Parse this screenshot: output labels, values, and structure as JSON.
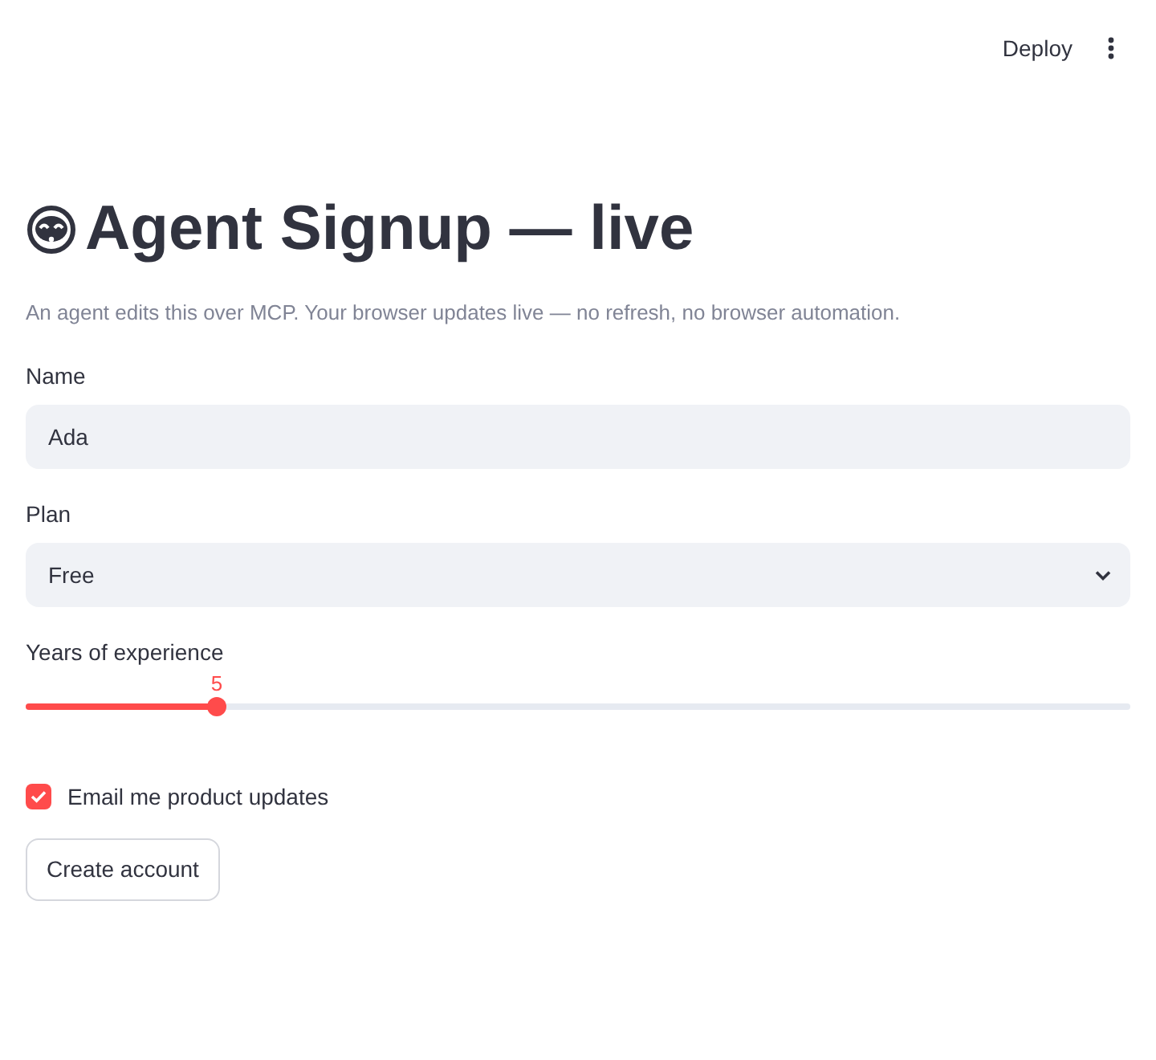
{
  "header": {
    "deploy": "Deploy"
  },
  "title": "Agent Signup — live",
  "subtitle": "An agent edits this over MCP. Your browser updates live — no refresh, no browser automation.",
  "fields": [
    {
      "kind": "text",
      "label": "Name",
      "value": "Ada"
    },
    {
      "kind": "select",
      "label": "Plan",
      "value": "Free"
    },
    {
      "kind": "slider",
      "label": "Years of experience",
      "reading": "5",
      "level": 0.173
    },
    {
      "kind": "checkbox",
      "label": "Email me product updates",
      "checked": true
    }
  ],
  "button": "Create account"
}
